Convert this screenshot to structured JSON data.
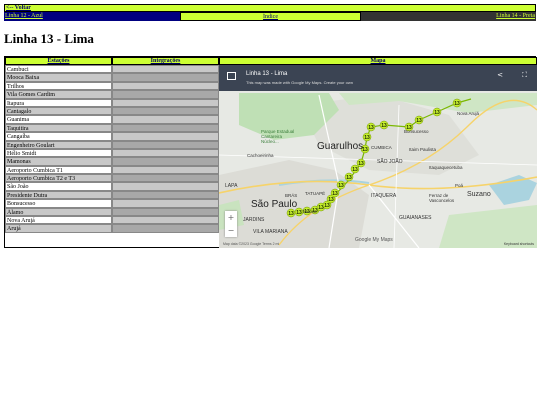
{
  "top": {
    "back_label": "<-- Voltar"
  },
  "nav": {
    "prev": "Linha 12 - Azul",
    "index": "Índice",
    "next": "Linha 14 - Preta"
  },
  "page_title": "Linha 13 - Lima",
  "table": {
    "headers": {
      "stations": "Estações",
      "integrations": "Integrações",
      "map": "Mapa"
    },
    "stations": [
      "Cambuci",
      "Mooca Baixa",
      "Trilhos",
      "Vila Gomes Cardim",
      "Itapura",
      "Cantagalo",
      "Guanima",
      "Taquitira",
      "Cangaíba",
      "Engenheiro Goulart",
      "Hélio Smidt",
      "Mamonas",
      "Aeroporto Cumbica T1",
      "Aeroporto Cumbica T2 e T3",
      "São João",
      "Presidente Dutra",
      "Bonsucesso",
      "Álamo",
      "Nova Arujá",
      "Arujá"
    ]
  },
  "map": {
    "title": "Linha 13 - Lima",
    "subtitle": "This map was made with Google My Maps. Create your own",
    "cities": {
      "guarulhos": "Guarulhos",
      "sao_paulo": "São Paulo",
      "suzano": "Suzano",
      "cumbica": "CUMBICA",
      "sao_joao": "SÃO JOÃO",
      "itaquera": "ITAQUERA",
      "tatuape": "TATUAPÉ",
      "bonsucesso": "Bonsucesso",
      "nova_aruja": "Nova Arujá",
      "guaianases": "GUAIANASES",
      "cantareira": "Parque Estadual Cantareira Núcleo...",
      "cachoeirinha": "Cachoeirinha",
      "itaim_paulista": "Itaim Paulista",
      "lapa": "LAPA",
      "jardins": "JARDINS",
      "vila_mariana": "VILA MARIANA",
      "ferraz": "Ferraz de Vasconcelos",
      "itaquaquecetuba": "Itaquaquecetuba",
      "poa": "Poá",
      "bras": "BRÁS",
      "mooca": "Mooca"
    },
    "marker_label": "13",
    "marker_count": 20,
    "zoom_in": "+",
    "zoom_out": "−",
    "credit": "Map data ©2023 Google   Terms   2 mi",
    "logo": "Google My Maps",
    "keys": "Keyboard shortcuts"
  }
}
